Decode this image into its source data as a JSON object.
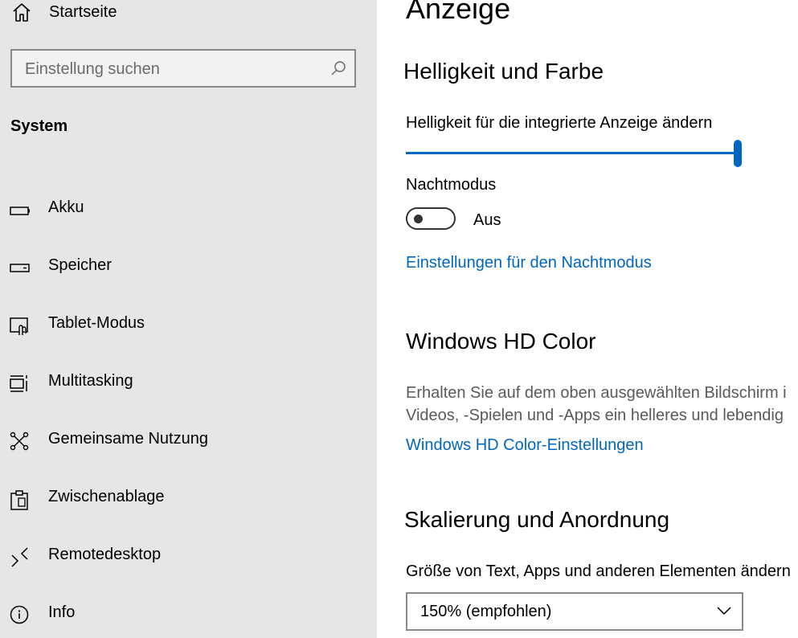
{
  "sidebar": {
    "home_label": "Startseite",
    "search_placeholder": "Einstellung suchen",
    "section": "System",
    "items": [
      {
        "label": "Akku",
        "icon": "battery-icon"
      },
      {
        "label": "Speicher",
        "icon": "storage-icon"
      },
      {
        "label": "Tablet-Modus",
        "icon": "tablet-mode-icon"
      },
      {
        "label": "Multitasking",
        "icon": "multitasking-icon"
      },
      {
        "label": "Gemeinsame Nutzung",
        "icon": "shared-experiences-icon"
      },
      {
        "label": "Zwischenablage",
        "icon": "clipboard-icon"
      },
      {
        "label": "Remotedesktop",
        "icon": "remote-desktop-icon"
      },
      {
        "label": "Info",
        "icon": "info-icon"
      }
    ]
  },
  "main": {
    "title": "Anzeige",
    "brightness": {
      "heading": "Helligkeit und Farbe",
      "slider_label": "Helligkeit für die integrierte Anzeige ändern",
      "value": 100
    },
    "night_mode": {
      "label": "Nachtmodus",
      "state": "Aus",
      "settings_link": "Einstellungen für den Nachtmodus"
    },
    "hd_color": {
      "heading": "Windows HD Color",
      "desc_line1": "Erhalten Sie auf dem oben ausgewählten Bildschirm i",
      "desc_line2": "Videos, -Spielen und -Apps ein helleres und lebendig",
      "link": "Windows HD Color-Einstellungen"
    },
    "scaling": {
      "heading": "Skalierung und Anordnung",
      "label": "Größe von Text, Apps und anderen Elementen ändern",
      "selected": "150% (empfohlen)"
    }
  },
  "colors": {
    "accent": "#0067c0",
    "sidebar_bg": "#e6e6e6",
    "content_bg": "#ffffff"
  }
}
